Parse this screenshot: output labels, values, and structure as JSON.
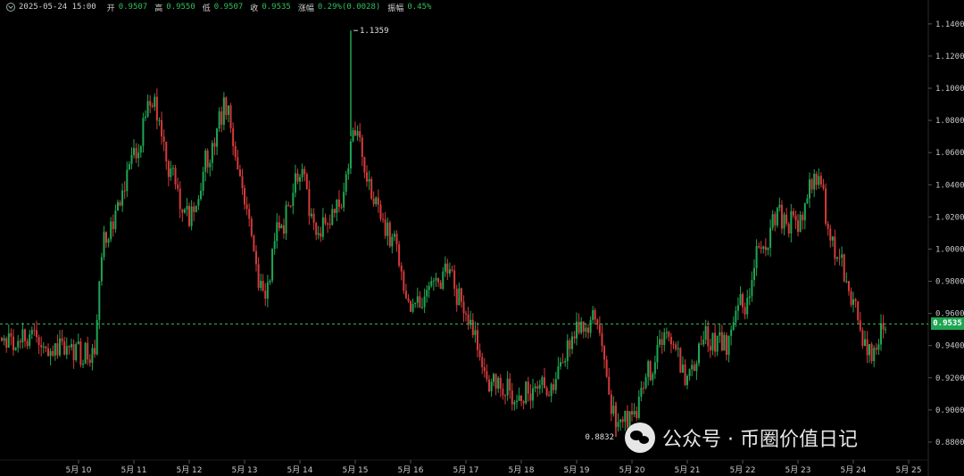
{
  "info_bar": {
    "datetime": "2025-05-24 15:00",
    "open_label": "开",
    "open": "0.9507",
    "high_label": "高",
    "high": "0.9550",
    "low_label": "低",
    "low": "0.9507",
    "close_label": "收",
    "close": "0.9535",
    "change_label": "涨幅",
    "change": "0.29%(0.0028)",
    "amplitude_label": "振幅",
    "amplitude": "0.45%"
  },
  "watermark": {
    "text": "公众号 · 币圈价值日记",
    "icon": "wechat-icon"
  },
  "colors": {
    "up": "#1fa653",
    "down": "#d63a3a",
    "background": "#000000",
    "price_line": "#2fbf5f"
  },
  "chart_data": {
    "type": "candlestick",
    "title": "",
    "ylim": [
      0.87,
      1.146
    ],
    "y_ticks": [
      "0.8800",
      "0.9000",
      "0.9200",
      "0.9400",
      "0.9600",
      "0.9800",
      "1.0000",
      "1.0200",
      "1.0400",
      "1.0600",
      "1.0800",
      "1.1000",
      "1.1200",
      "1.1400"
    ],
    "x_ticks": [
      "5月 10",
      "5月 11",
      "5月 12",
      "5月 13",
      "5月 14",
      "5月 15",
      "5月 16",
      "5月 17",
      "5月 18",
      "5月 19",
      "5月 20",
      "5月 21",
      "5月 22",
      "5月 23",
      "5月 24",
      "5月 25"
    ],
    "current_price": "0.9535",
    "max_label": "1.1359",
    "min_label": "0.8832",
    "anchor_path": [
      [
        "5月 10",
        0.945
      ],
      [
        null,
        0.935
      ],
      [
        null,
        1.01
      ],
      [
        null,
        1.03
      ],
      [
        "5月 11",
        1.06
      ],
      [
        null,
        1.095
      ],
      [
        null,
        1.045
      ],
      [
        "5月 12",
        1.02
      ],
      [
        null,
        1.055
      ],
      [
        null,
        1.09
      ],
      [
        "5月 13",
        1.03
      ],
      [
        null,
        0.975
      ],
      [
        null,
        1.015
      ],
      [
        "5月 14",
        1.045
      ],
      [
        null,
        1.01
      ],
      [
        null,
        1.025
      ],
      [
        "5月 15",
        1.07
      ],
      [
        null,
        1.03
      ],
      [
        null,
        1.005
      ],
      [
        "5月 16",
        0.96
      ],
      [
        null,
        0.975
      ],
      [
        null,
        0.985
      ],
      [
        "5月 17",
        0.96
      ],
      [
        null,
        0.915
      ],
      [
        "5月 18",
        0.91
      ],
      [
        null,
        0.915
      ],
      [
        "5月 19",
        0.95
      ],
      [
        null,
        0.955
      ],
      [
        null,
        0.895
      ],
      [
        "5月 20",
        0.895
      ],
      [
        null,
        0.925
      ],
      [
        null,
        0.95
      ],
      [
        "5月 21",
        0.92
      ],
      [
        null,
        0.945
      ],
      [
        null,
        0.94
      ],
      [
        "5月 22",
        0.965
      ],
      [
        null,
        1.0
      ],
      [
        null,
        1.02
      ],
      [
        "5月 23",
        1.015
      ],
      [
        null,
        1.045
      ],
      [
        null,
        1.0
      ],
      [
        "5月 24",
        0.965
      ],
      [
        null,
        0.935
      ],
      [
        null,
        0.9535
      ]
    ]
  }
}
